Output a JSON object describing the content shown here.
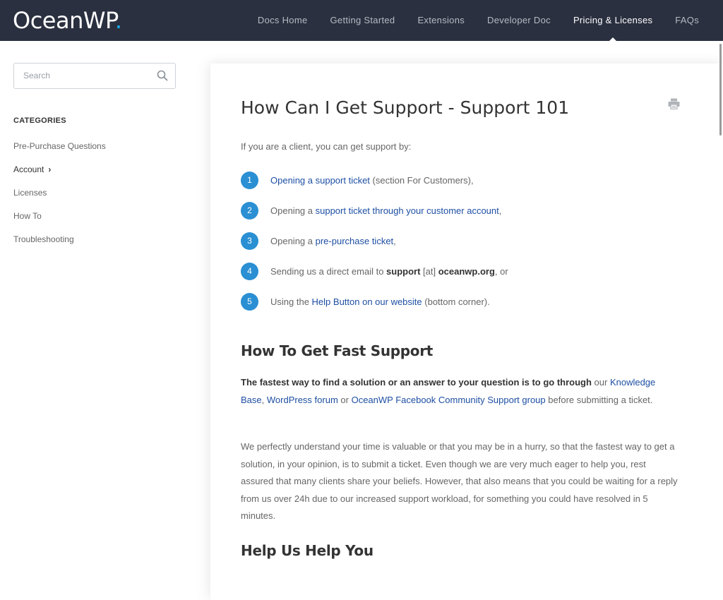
{
  "header": {
    "logo_text": "OceanWP",
    "logo_dot": ".",
    "nav": [
      {
        "label": "Docs Home"
      },
      {
        "label": "Getting Started"
      },
      {
        "label": "Extensions"
      },
      {
        "label": "Developer Doc"
      },
      {
        "label": "Pricing & Licenses"
      },
      {
        "label": "FAQs"
      }
    ],
    "active_nav": "Pricing & Licenses"
  },
  "sidebar": {
    "search_placeholder": "Search",
    "categories_title": "CATEGORIES",
    "categories": [
      {
        "label": "Pre-Purchase Questions"
      },
      {
        "label": "Account",
        "chevron": "›"
      },
      {
        "label": "Licenses"
      },
      {
        "label": "How To"
      },
      {
        "label": "Troubleshooting"
      }
    ]
  },
  "article": {
    "title": "How Can I Get Support - Support 101",
    "intro": "If you are a client, you can get support by:",
    "steps": [
      {
        "num": "1",
        "a": "Opening a support ticket",
        "b": " (section For Customers),"
      },
      {
        "num": "2",
        "pre": "Opening a ",
        "a": "support ticket through your customer account",
        "post": ","
      },
      {
        "num": "3",
        "pre": "Opening a ",
        "a": "pre-purchase ticket",
        "post": ","
      },
      {
        "num": "4",
        "pre": "Sending us a direct email to ",
        "s1": "support",
        "mid": " [at] ",
        "s2": "oceanwp.org",
        "post": ", or"
      },
      {
        "num": "5",
        "pre": "Using the ",
        "a": "Help Button on our website",
        "post": " (bottom corner)."
      }
    ],
    "h2_fast": "How To Get Fast Support",
    "fast_para": {
      "bold": "The fastest way to find a solution or an answer to your question is to go through",
      "t1": " our ",
      "l1": "Knowledge Base",
      "t2": ", ",
      "l2": "WordPress forum",
      "t3": " or ",
      "l3": "OceanWP Facebook Community Support group",
      "t4": " before submitting a ticket."
    },
    "understand_para": "We perfectly understand your time is valuable or that you may be in a hurry, so that the fastest way to get a solution, in your opinion, is to submit a ticket. Even though we are very much eager to help you, rest assured that many clients share your beliefs. However, that also means that you could be waiting for a reply from us over 24h due to our increased support workload, for something you could have resolved in 5 minutes.",
    "h2_help": "Help Us Help You"
  },
  "colors": {
    "header_bg": "#2b3040",
    "accent_blue": "#13aff0",
    "link": "#1e4fa3",
    "step_badge": "#2a8fd3"
  }
}
